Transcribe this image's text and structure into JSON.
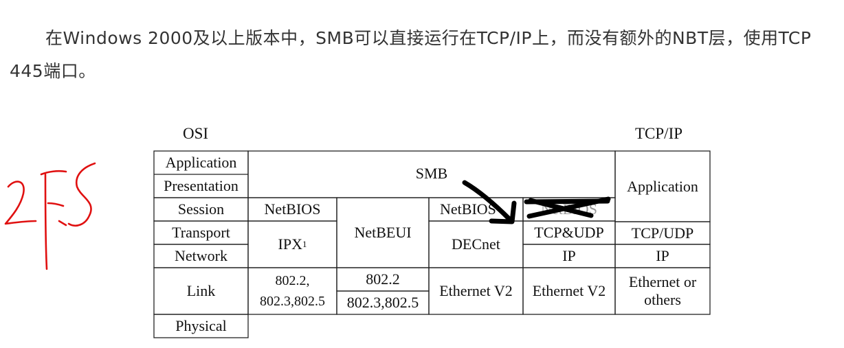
{
  "paragraph": "在Windows 2000及以上版本中，SMB可以直接运行在TCP/IP上，而没有额外的NBT层，使用TCP 445端口。",
  "figure": {
    "osi_label": "OSI",
    "tcpip_label": "TCP/IP",
    "osi_layers": [
      "Application",
      "Presentation",
      "Session",
      "Transport",
      "Network",
      "Link",
      "Physical"
    ],
    "smb": "SMB",
    "netbios": "NetBIOS",
    "netbeui": "NetBEUI",
    "netbios_dec": "NetBIOS",
    "netbios_tcp": "NetBIOS",
    "ipx": "IPX",
    "ipx_sup": "1",
    "decnet": "DECnet",
    "tcp_udp_amp": "TCP&UDP",
    "ip_mid": "IP",
    "link_8022_a": "802.2,",
    "link_8023_a": "802.3,802.5",
    "link_8022_b": "802.2",
    "link_8023_b": "802.3,802.5",
    "ethernet_v2_a": "Ethernet V2",
    "ethernet_v2_b": "Ethernet V2",
    "tcpip_application": "Application",
    "tcpip_transport": "TCP/UDP",
    "tcpip_ip": "IP",
    "tcpip_link_1": "Ethernet or",
    "tcpip_link_2": "others",
    "handwritten_note": "2FS"
  }
}
